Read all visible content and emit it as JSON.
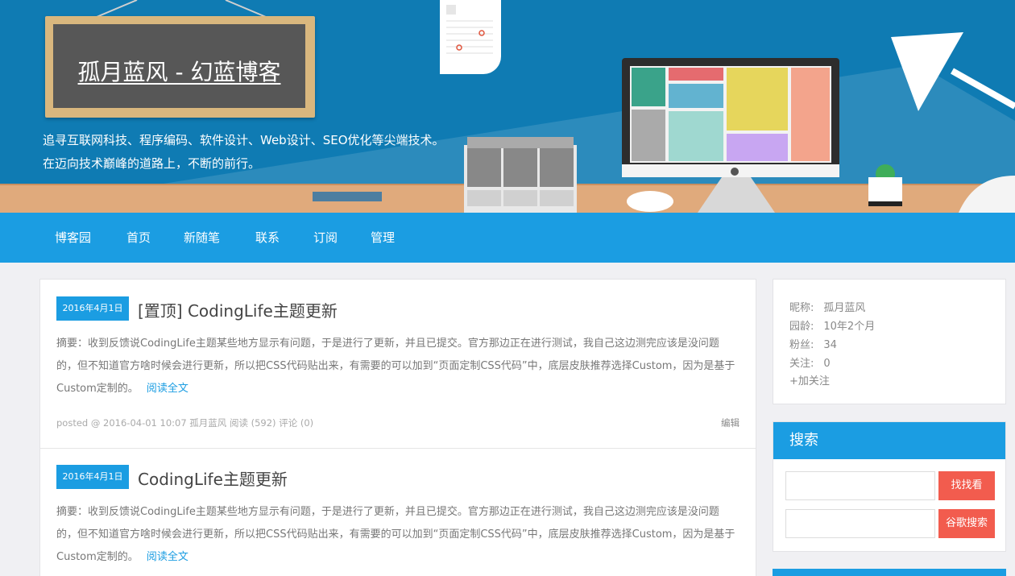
{
  "header": {
    "blog_title": "孤月蓝风 - 幻蓝博客",
    "slogan_line1": "追寻互联网科技、程序编码、软件设计、Web设计、SEO优化等尖端技术。",
    "slogan_line2": "在迈向技术巅峰的道路上，不断的前行。"
  },
  "nav": {
    "items": [
      {
        "label": "博客园"
      },
      {
        "label": "首页"
      },
      {
        "label": "新随笔"
      },
      {
        "label": "联系"
      },
      {
        "label": "订阅"
      },
      {
        "label": "管理"
      }
    ]
  },
  "posts": [
    {
      "date": "2016年4月1日",
      "title": "[置顶] CodingLife主题更新",
      "summary": "摘要：收到反馈说CodingLife主题某些地方显示有问题，于是进行了更新，并且已提交。官方那边正在进行测试，我自己这边测完应该是没问题的，但不知道官方啥时候会进行更新，所以把CSS代码贴出来，有需要的可以加到“页面定制CSS代码”中，底层皮肤推荐选择Custom，因为是基于Custom定制的。",
      "read_more": "阅读全文",
      "meta": "posted @ 2016-04-01 10:07 孤月蓝风 阅读 (592) 评论 (0)",
      "edit": "编辑"
    },
    {
      "date": "2016年4月1日",
      "title": "CodingLife主题更新",
      "summary": "摘要：收到反馈说CodingLife主题某些地方显示有问题，于是进行了更新，并且已提交。官方那边正在进行测试，我自己这边测完应该是没问题的，但不知道官方啥时候会进行更新，所以把CSS代码贴出来，有需要的可以加到“页面定制CSS代码”中，底层皮肤推荐选择Custom，因为是基于Custom定制的。",
      "read_more": "阅读全文"
    }
  ],
  "profile": {
    "nickname_label": "昵称:",
    "nickname": "孤月蓝风",
    "age_label": "园龄:",
    "age": "10年2个月",
    "fans_label": "粉丝:",
    "fans": "34",
    "follow_label": "关注:",
    "follow": "0",
    "add_follow": "+加关注"
  },
  "search": {
    "title": "搜索",
    "find_button": "找找看",
    "google_button": "谷歌搜索"
  },
  "colors": {
    "banner": "#0f7bb3",
    "nav": "#1b9de2",
    "accent": "#1b9de2",
    "button": "#f25c4e"
  }
}
